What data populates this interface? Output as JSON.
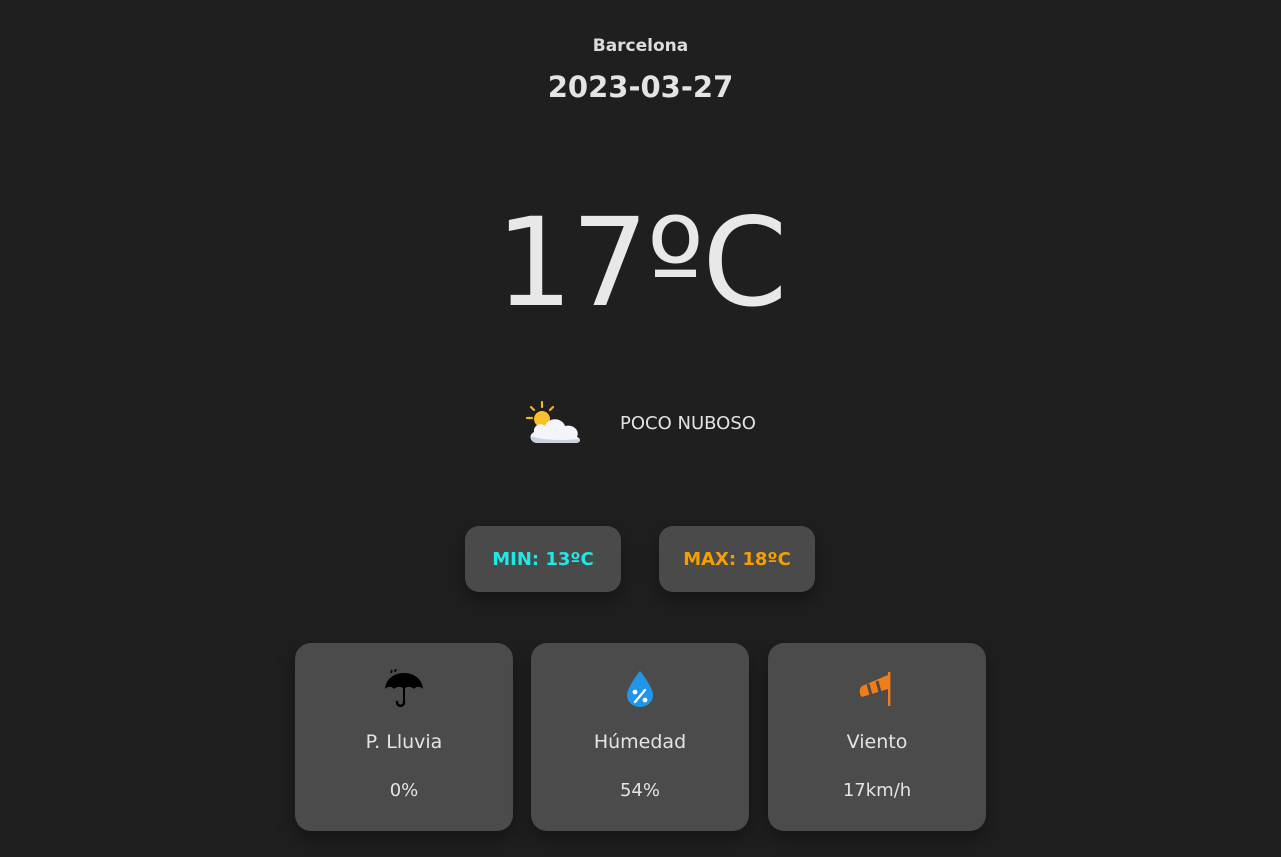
{
  "location": {
    "city": "Barcelona",
    "date": "2023-03-27"
  },
  "current": {
    "temperature": "17ºC",
    "condition": "POCO NUBOSO",
    "condition_icon": "partly-cloudy-icon"
  },
  "range": {
    "min_label": "MIN: 13ºC",
    "max_label": "MAX: 18ºC",
    "min_color": "#1de9e6",
    "max_color": "#f5a000"
  },
  "details": [
    {
      "icon": "umbrella-icon",
      "label": "P. Lluvia",
      "value": "0%"
    },
    {
      "icon": "humidity-drop-icon",
      "label": "Húmedad",
      "value": "54%"
    },
    {
      "icon": "windsock-icon",
      "label": "Viento",
      "value": "17km/h"
    }
  ]
}
